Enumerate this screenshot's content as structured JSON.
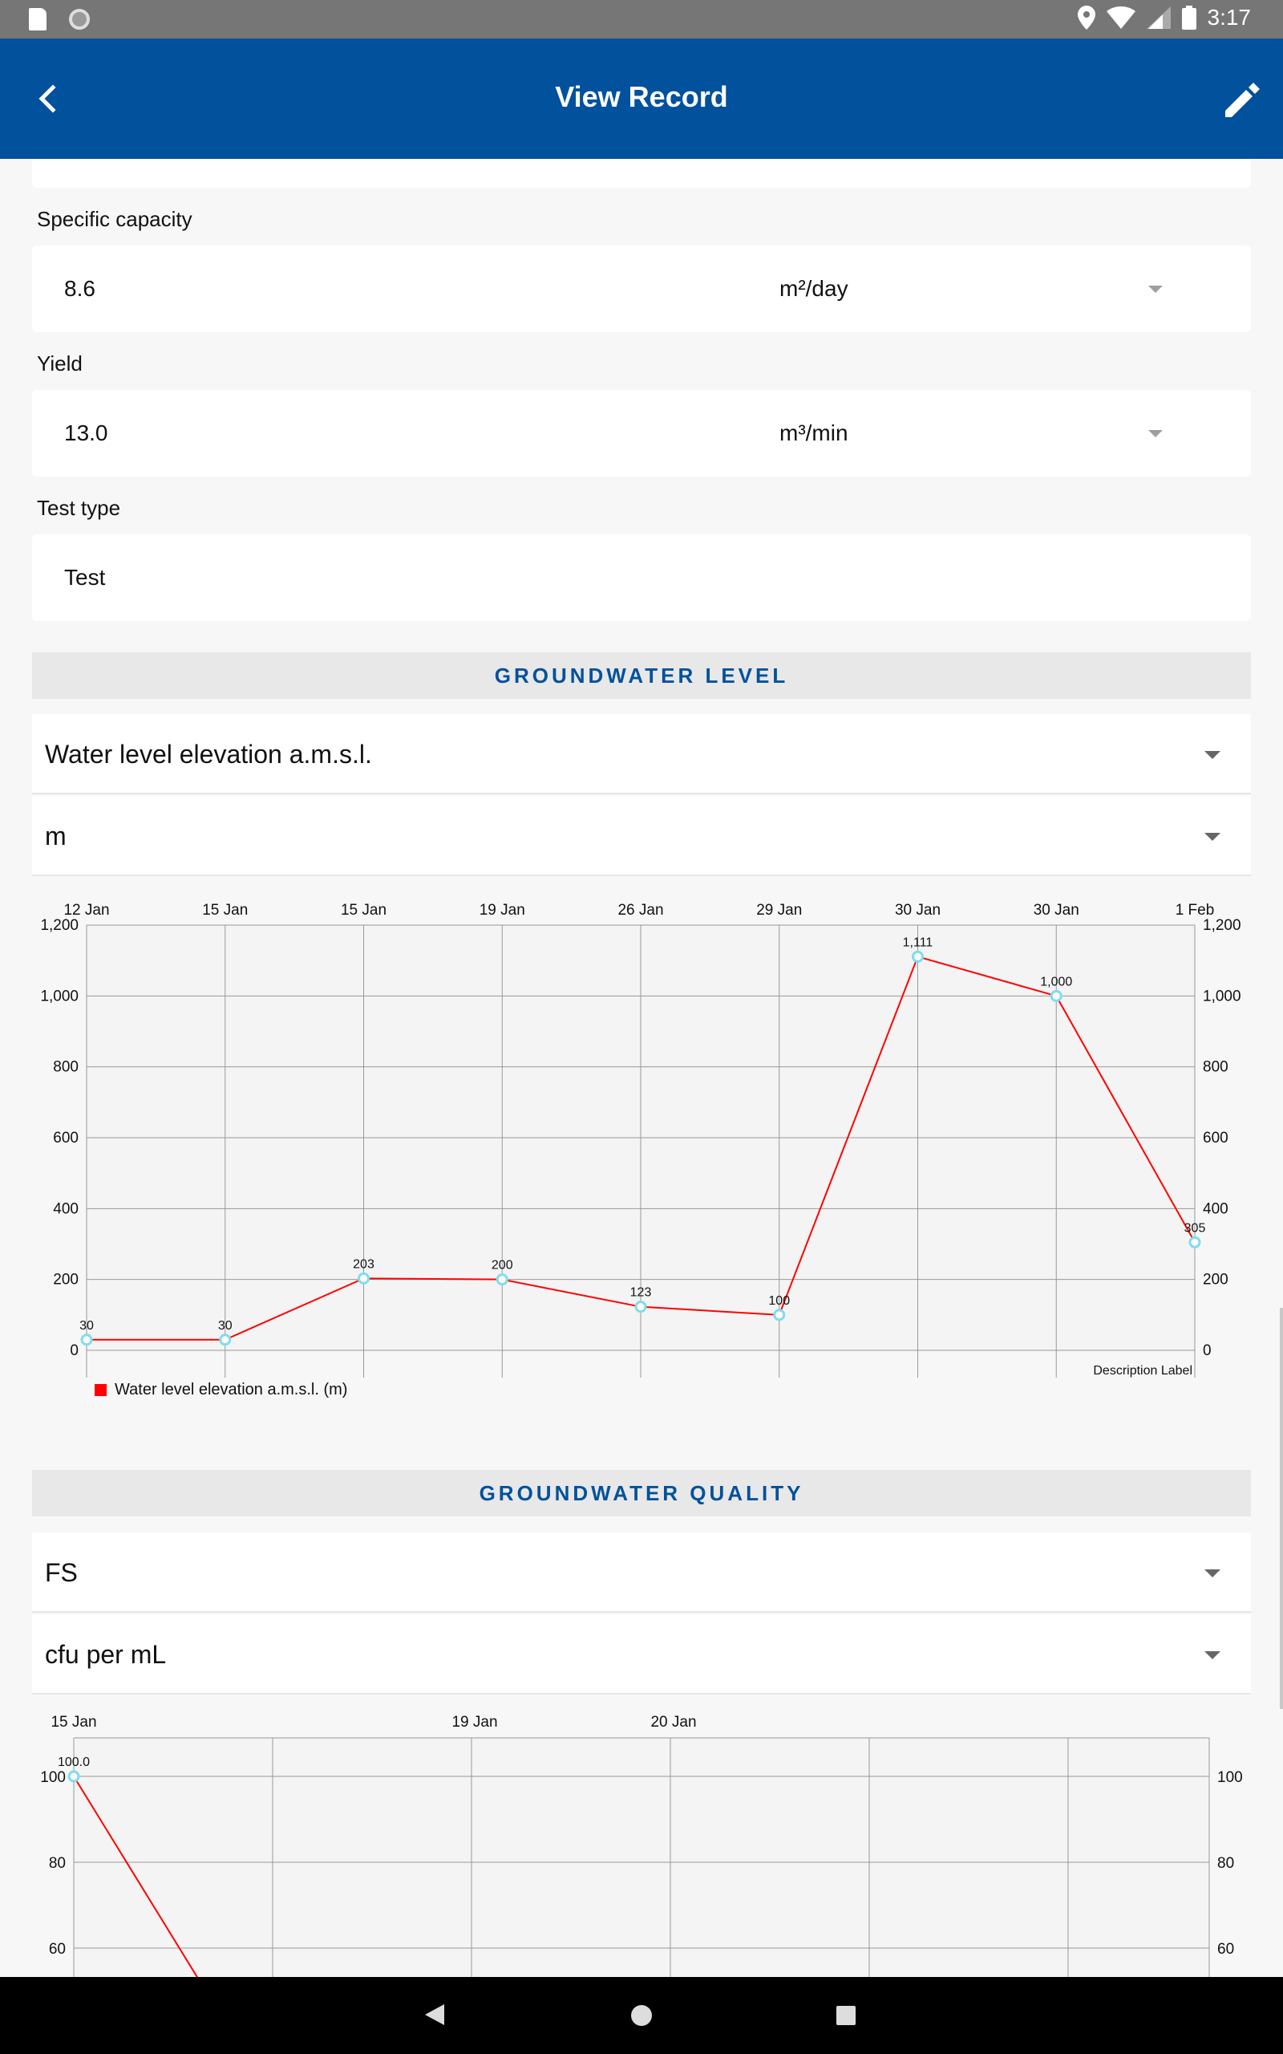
{
  "status_bar": {
    "time": "3:17"
  },
  "app_bar": {
    "title": "View Record"
  },
  "form": {
    "specific_capacity": {
      "label": "Specific capacity",
      "value": "8.6",
      "unit": "m²/day"
    },
    "yield": {
      "label": "Yield",
      "value": "13.0",
      "unit": "m³/min"
    },
    "test_type": {
      "label": "Test type",
      "value": "Test"
    }
  },
  "groundwater_level": {
    "heading": "GROUNDWATER LEVEL",
    "parameter": "Water level elevation a.m.s.l.",
    "unit": "m"
  },
  "groundwater_quality": {
    "heading": "GROUNDWATER QUALITY",
    "parameter": "FS",
    "unit": "cfu per mL"
  },
  "colors": {
    "accent": "#01519c",
    "series": "#ff0000",
    "point": "#7fdcef"
  },
  "chart_data": [
    {
      "type": "line",
      "categories": [
        "12 Jan",
        "15 Jan",
        "15 Jan",
        "19 Jan",
        "26 Jan",
        "29 Jan",
        "30 Jan",
        "30 Jan",
        "1 Feb"
      ],
      "series": [
        {
          "name": "Water level elevation a.m.s.l. (m)",
          "values": [
            30,
            30,
            203,
            200,
            123,
            100,
            1111,
            1000,
            305
          ]
        }
      ],
      "data_labels": [
        "30",
        "30",
        "203",
        "200",
        "123",
        "100",
        "1,111",
        "1,000",
        "305"
      ],
      "yticks": [
        "0",
        "200",
        "400",
        "600",
        "800",
        "1,000",
        "1,200"
      ],
      "ylim": [
        0,
        1200
      ],
      "description": "Description Label",
      "legend": "bottom-left",
      "grid": true
    },
    {
      "type": "line",
      "tick_labels": [
        "15 Jan",
        "19 Jan",
        "20 Jan"
      ],
      "series": [
        {
          "name": "",
          "values": [
            100.0
          ]
        }
      ],
      "data_labels": [
        "100.0"
      ],
      "yticks": [
        "60",
        "80",
        "100"
      ],
      "ylim": [
        60,
        100
      ],
      "grid": true
    }
  ]
}
